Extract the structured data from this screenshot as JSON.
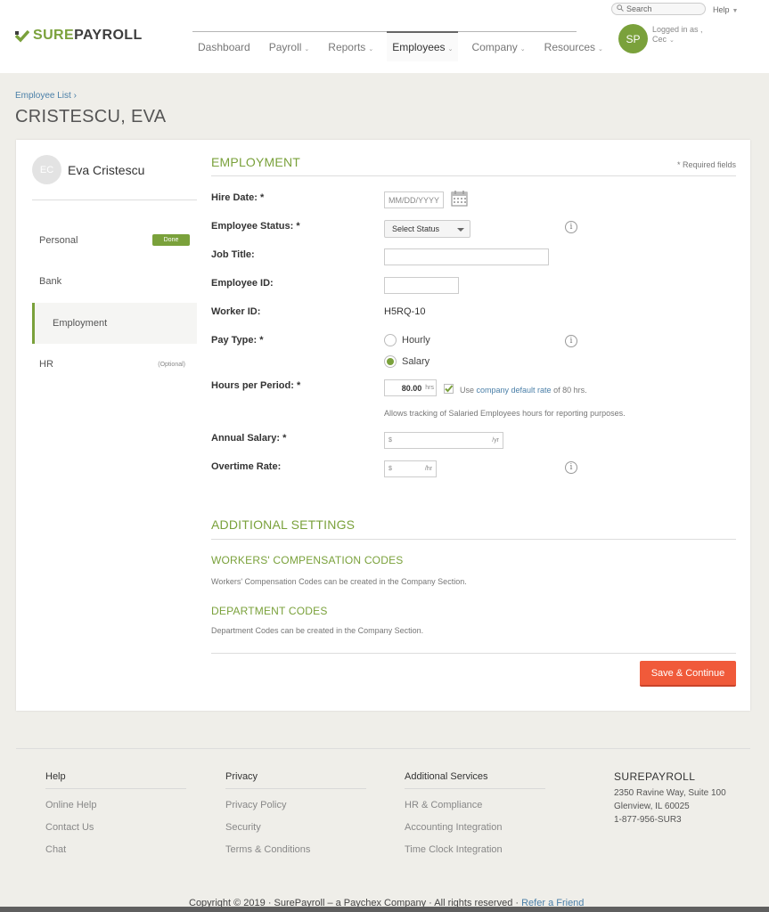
{
  "brand": {
    "sure": "SURE",
    "payroll": "PAYROLL"
  },
  "search": {
    "placeholder": "Search"
  },
  "help_menu": "Help",
  "nav": [
    {
      "label": "Dashboard",
      "chevron": false
    },
    {
      "label": "Payroll",
      "chevron": true
    },
    {
      "label": "Reports",
      "chevron": true
    },
    {
      "label": "Employees",
      "chevron": true,
      "active": true
    },
    {
      "label": "Company",
      "chevron": true
    },
    {
      "label": "Resources",
      "chevron": true
    }
  ],
  "user": {
    "initials": "SP",
    "logged_in_as": "Logged in as ,",
    "name": "Cec"
  },
  "breadcrumb": "Employee List ›",
  "page_title": "CRISTESCU, EVA",
  "employee": {
    "initials": "EC",
    "name": "Eva Cristescu"
  },
  "sidebar": {
    "personal": "Personal",
    "done": "Done",
    "bank": "Bank",
    "employment": "Employment",
    "hr": "HR",
    "optional": "(Optional)"
  },
  "employment": {
    "title": "EMPLOYMENT",
    "required_note": "* Required fields",
    "hire_date": {
      "label": "Hire Date: *",
      "placeholder": "MM/DD/YYYY"
    },
    "status": {
      "label": "Employee Status: *",
      "value": "Select Status"
    },
    "job_title": {
      "label": "Job Title:",
      "value": ""
    },
    "employee_id": {
      "label": "Employee ID:",
      "value": ""
    },
    "worker_id": {
      "label": "Worker ID:",
      "value": "H5RQ-10"
    },
    "pay_type": {
      "label": "Pay Type: *",
      "hourly": "Hourly",
      "salary": "Salary",
      "selected": "Salary"
    },
    "hours": {
      "label": "Hours per Period: *",
      "value": "80.00",
      "unit": "hrs",
      "use_prefix": "Use ",
      "link": "company default rate",
      "use_suffix": " of 80 hrs.",
      "checked": true,
      "note": "Allows tracking of Salaried Employees hours for reporting purposes."
    },
    "annual_salary": {
      "label": "Annual Salary: *",
      "prefix": "$",
      "suffix": "/yr"
    },
    "overtime": {
      "label": "Overtime Rate:",
      "prefix": "$",
      "suffix": "/hr"
    }
  },
  "additional": {
    "title": "ADDITIONAL SETTINGS",
    "workers_comp_title": "WORKERS' COMPENSATION CODES",
    "workers_comp_note": "Workers' Compensation Codes can be created in the Company Section.",
    "dept_title": "DEPARTMENT CODES",
    "dept_note": "Department Codes can be created in the Company Section."
  },
  "save_button": "Save & Continue",
  "footer": {
    "columns": [
      {
        "head": "Help",
        "links": [
          "Online Help",
          "Contact Us",
          "Chat"
        ]
      },
      {
        "head": "Privacy",
        "links": [
          "Privacy Policy",
          "Security",
          "Terms & Conditions"
        ]
      },
      {
        "head": "Additional Services",
        "links": [
          "HR & Compliance",
          "Accounting Integration",
          "Time Clock Integration"
        ]
      }
    ],
    "brand": "SUREPAYROLL",
    "address1": "2350 Ravine Way, Suite 100",
    "address2": "Glenview, IL 60025",
    "phone": "1-877-956-SUR3",
    "copyright": "Copyright © 2019 · SurePayroll – a Paychex Company · All rights reserved · ",
    "refer": "Refer a Friend"
  },
  "colors": {
    "brand_green": "#7aa13b",
    "cta": "#f05a3a",
    "link": "#4a7fa8"
  }
}
